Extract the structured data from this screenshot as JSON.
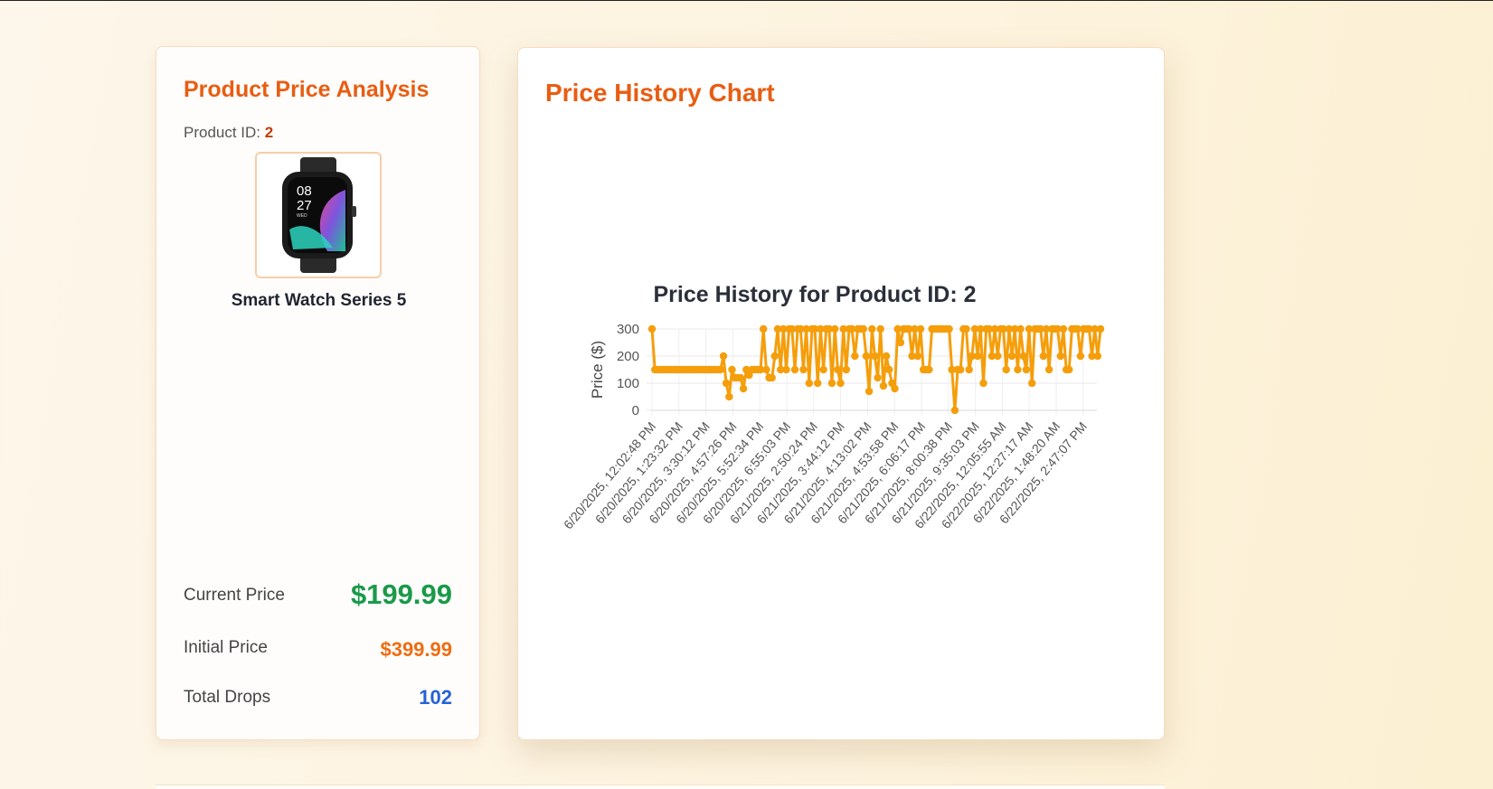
{
  "left_panel": {
    "title": "Product Price Analysis",
    "product_id_label": "Product ID:",
    "product_id": "2",
    "watch_time_hour": "08",
    "watch_time_minute": "27",
    "watch_day": "WED",
    "product_name": "Smart Watch Series 5",
    "current_price_label": "Current Price",
    "current_price": "$199.99",
    "initial_price_label": "Initial Price",
    "initial_price": "$399.99",
    "total_drops_label": "Total Drops",
    "total_drops": "102"
  },
  "right_panel": {
    "title": "Price History Chart"
  },
  "chart_data": {
    "type": "line",
    "title": "Price History for Product ID: 2",
    "xlabel": "",
    "ylabel": "Price ($)",
    "ylim": [
      0,
      300
    ],
    "yticks": [
      0,
      100,
      200,
      300
    ],
    "grid": true,
    "legend": "none",
    "color": "#f59e0b",
    "x_tick_labels": [
      "6/20/2025, 12:02:48 PM",
      "6/20/2025, 1:23:32 PM",
      "6/20/2025, 3:30:12 PM",
      "6/20/2025, 4:57:26 PM",
      "6/20/2025, 5:52:34 PM",
      "6/20/2025, 6:55:03 PM",
      "6/21/2025, 2:50:24 PM",
      "6/21/2025, 3:44:12 PM",
      "6/21/2025, 4:13:02 PM",
      "6/21/2025, 4:53:58 PM",
      "6/21/2025, 6:06:17 PM",
      "6/21/2025, 8:00:38 PM",
      "6/21/2025, 9:35:03 PM",
      "6/22/2025, 12:05:55 AM",
      "6/22/2025, 12:27:17 AM",
      "6/22/2025, 1:48:20 AM",
      "6/22/2025, 2:47:07 PM"
    ],
    "values": [
      300,
      150,
      150,
      150,
      150,
      150,
      150,
      150,
      150,
      150,
      150,
      150,
      150,
      150,
      150,
      150,
      150,
      150,
      150,
      150,
      150,
      150,
      150,
      150,
      150,
      200,
      100,
      50,
      150,
      120,
      120,
      120,
      80,
      150,
      130,
      150,
      150,
      150,
      150,
      300,
      150,
      120,
      120,
      200,
      300,
      150,
      300,
      150,
      300,
      300,
      150,
      300,
      300,
      150,
      300,
      100,
      300,
      300,
      100,
      300,
      150,
      300,
      300,
      100,
      300,
      150,
      100,
      300,
      150,
      300,
      300,
      200,
      300,
      300,
      300,
      200,
      70,
      300,
      200,
      120,
      300,
      90,
      200,
      150,
      100,
      80,
      300,
      250,
      300,
      300,
      300,
      200,
      300,
      200,
      300,
      150,
      150,
      150,
      300,
      300,
      300,
      300,
      300,
      300,
      300,
      150,
      0,
      150,
      150,
      300,
      300,
      150,
      200,
      300,
      200,
      300,
      100,
      300,
      300,
      200,
      300,
      200,
      300,
      300,
      150,
      300,
      200,
      300,
      150,
      300,
      200,
      150,
      300,
      100,
      300,
      300,
      300,
      200,
      300,
      150,
      300,
      300,
      300,
      200,
      300,
      150,
      150,
      300,
      300,
      300,
      200,
      300,
      300,
      300,
      200,
      300,
      200,
      300
    ]
  }
}
